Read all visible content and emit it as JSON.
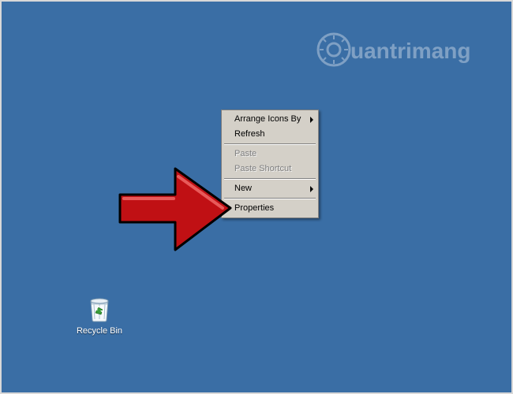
{
  "desktop": {
    "background_color": "#3a6ea5",
    "watermark_text": "uantrimang"
  },
  "icons": {
    "recycle_bin": {
      "label": "Recycle Bin"
    }
  },
  "context_menu": {
    "items": [
      {
        "label": "Arrange Icons By",
        "has_submenu": true,
        "enabled": true
      },
      {
        "label": "Refresh",
        "has_submenu": false,
        "enabled": true
      }
    ],
    "items2": [
      {
        "label": "Paste",
        "has_submenu": false,
        "enabled": false
      },
      {
        "label": "Paste Shortcut",
        "has_submenu": false,
        "enabled": false
      }
    ],
    "items3": [
      {
        "label": "New",
        "has_submenu": true,
        "enabled": true
      }
    ],
    "items4": [
      {
        "label": "Properties",
        "has_submenu": false,
        "enabled": true
      }
    ]
  },
  "annotation": {
    "arrow_color": "#b00000",
    "arrow_highlight": "Properties"
  }
}
